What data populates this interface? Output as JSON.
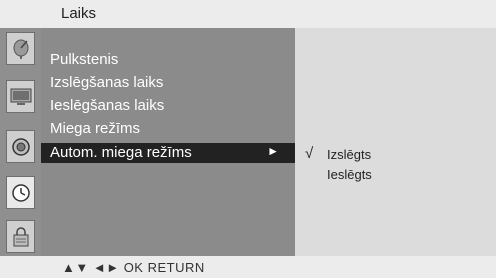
{
  "title": "Laiks",
  "sidebar_icons": [
    {
      "name": "satellite-dish-icon",
      "active": false
    },
    {
      "name": "tv-picture-icon",
      "active": false
    },
    {
      "name": "audio-speaker-icon",
      "active": false
    },
    {
      "name": "clock-icon",
      "active": true
    },
    {
      "name": "lock-icon",
      "active": false
    }
  ],
  "menu": {
    "items": [
      {
        "label": "Pulkstenis"
      },
      {
        "label": "Izslēgšanas laiks"
      },
      {
        "label": "Ieslēgšanas laiks"
      },
      {
        "label": "Miega režīms"
      },
      {
        "label": "Autom. miega režīms",
        "selected": true,
        "arrow": "►"
      }
    ]
  },
  "submenu": {
    "checkmark": "√",
    "options": [
      "Izslēgts",
      "Ieslēgts"
    ],
    "checked_index": 0
  },
  "footer": {
    "hints": "▲▼  ◄►  OK  RETURN"
  }
}
